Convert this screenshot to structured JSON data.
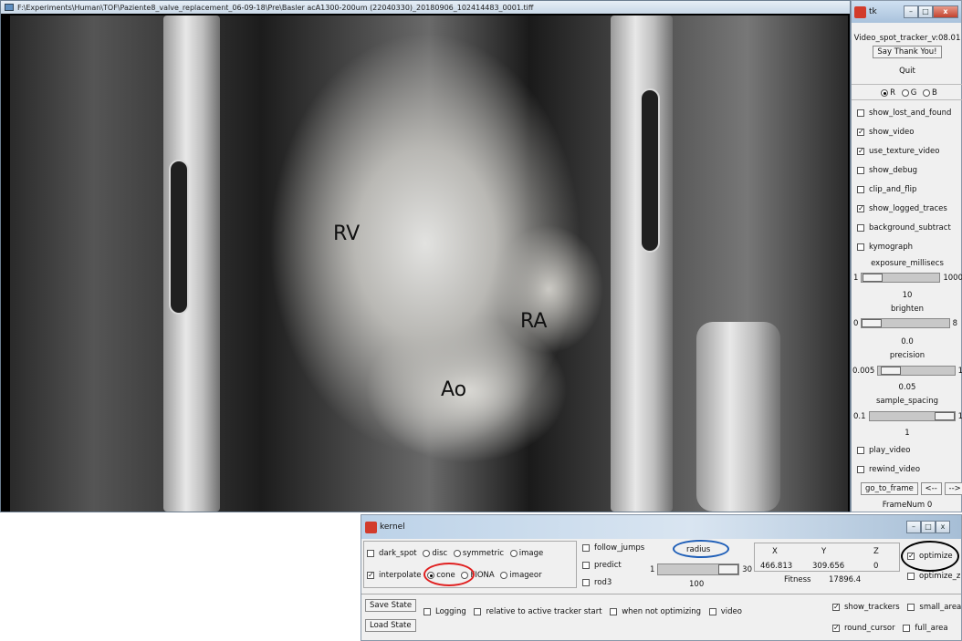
{
  "video_window": {
    "title": "F:\\Experiments\\Human\\TOF\\Paziente8_valve_replacement_06-09-18\\Pre\\Basler acA1300-200um (22040330)_20180906_102414483_0001.tiff",
    "labels": [
      "RV",
      "RA",
      "Ao"
    ]
  },
  "tk_panel": {
    "title": "tk",
    "window_buttons": [
      "–",
      "□",
      "x"
    ],
    "version": "Video_spot_tracker_v:08.01",
    "say_thanks": "Say Thank You!",
    "quit": "Quit",
    "color_channels": [
      {
        "label": "R",
        "selected": true
      },
      {
        "label": "G",
        "selected": false
      },
      {
        "label": "B",
        "selected": false
      }
    ],
    "checkboxes": [
      {
        "label": "show_lost_and_found",
        "checked": false
      },
      {
        "label": "show_video",
        "checked": true
      },
      {
        "label": "use_texture_video",
        "checked": true
      },
      {
        "label": "show_debug",
        "checked": false
      },
      {
        "label": "clip_and_flip",
        "checked": false
      },
      {
        "label": "show_logged_traces",
        "checked": true
      },
      {
        "label": "background_subtract",
        "checked": false
      },
      {
        "label": "kymograph",
        "checked": false
      }
    ],
    "sliders": [
      {
        "name": "exposure_millisecs",
        "min": "1",
        "max": "1000",
        "value": "10",
        "fraction": 0.01
      },
      {
        "name": "brighten",
        "min": "0",
        "max": "8",
        "value": "0.0",
        "fraction": 0.0
      },
      {
        "name": "precision",
        "min": "0.005",
        "max": "1",
        "value": "0.05",
        "fraction": 0.05
      },
      {
        "name": "sample_spacing",
        "min": "0.1",
        "max": "1",
        "value": "1",
        "fraction": 1.0
      }
    ],
    "play_video": "play_video",
    "rewind_video": "rewind_video",
    "go_to_frame": "go_to_frame",
    "prev": "<--",
    "next": "-->",
    "frame_num": "FrameNum 0"
  },
  "kernel": {
    "title": "kernel",
    "dark_spot": "dark_spot",
    "interpolate": "interpolate",
    "kernels": [
      "disc",
      "cone",
      "symmetric",
      "FIONA",
      "image",
      "imageor"
    ],
    "selected_kernel": "cone",
    "follow_jumps": "follow_jumps",
    "predict": "predict",
    "rod3": "rod3",
    "radius_label": "radius",
    "radius_min": "1",
    "radius_max": "30",
    "radius_value": "100",
    "radius_fraction": 1.0,
    "coords": {
      "headers": [
        "X",
        "Y",
        "Z"
      ],
      "values": [
        "466.813",
        "309.656",
        "0"
      ]
    },
    "fitness_label": "Fitness",
    "fitness_value": "17896.4",
    "optimize": "optimize",
    "optimize_z": "optimize_z",
    "save_state": "Save State",
    "load_state": "Load State",
    "logging": "Logging",
    "relative": "relative to active tracker start",
    "when_not_optimizing": "when not optimizing",
    "video": "video",
    "show_trackers": "show_trackers",
    "small_area": "small_area",
    "round_cursor": "round_cursor",
    "full_area": "full_area"
  },
  "annotation_colors": {
    "cone": "#e02020",
    "radius": "#1f5fb8",
    "optimize": "#000000"
  }
}
